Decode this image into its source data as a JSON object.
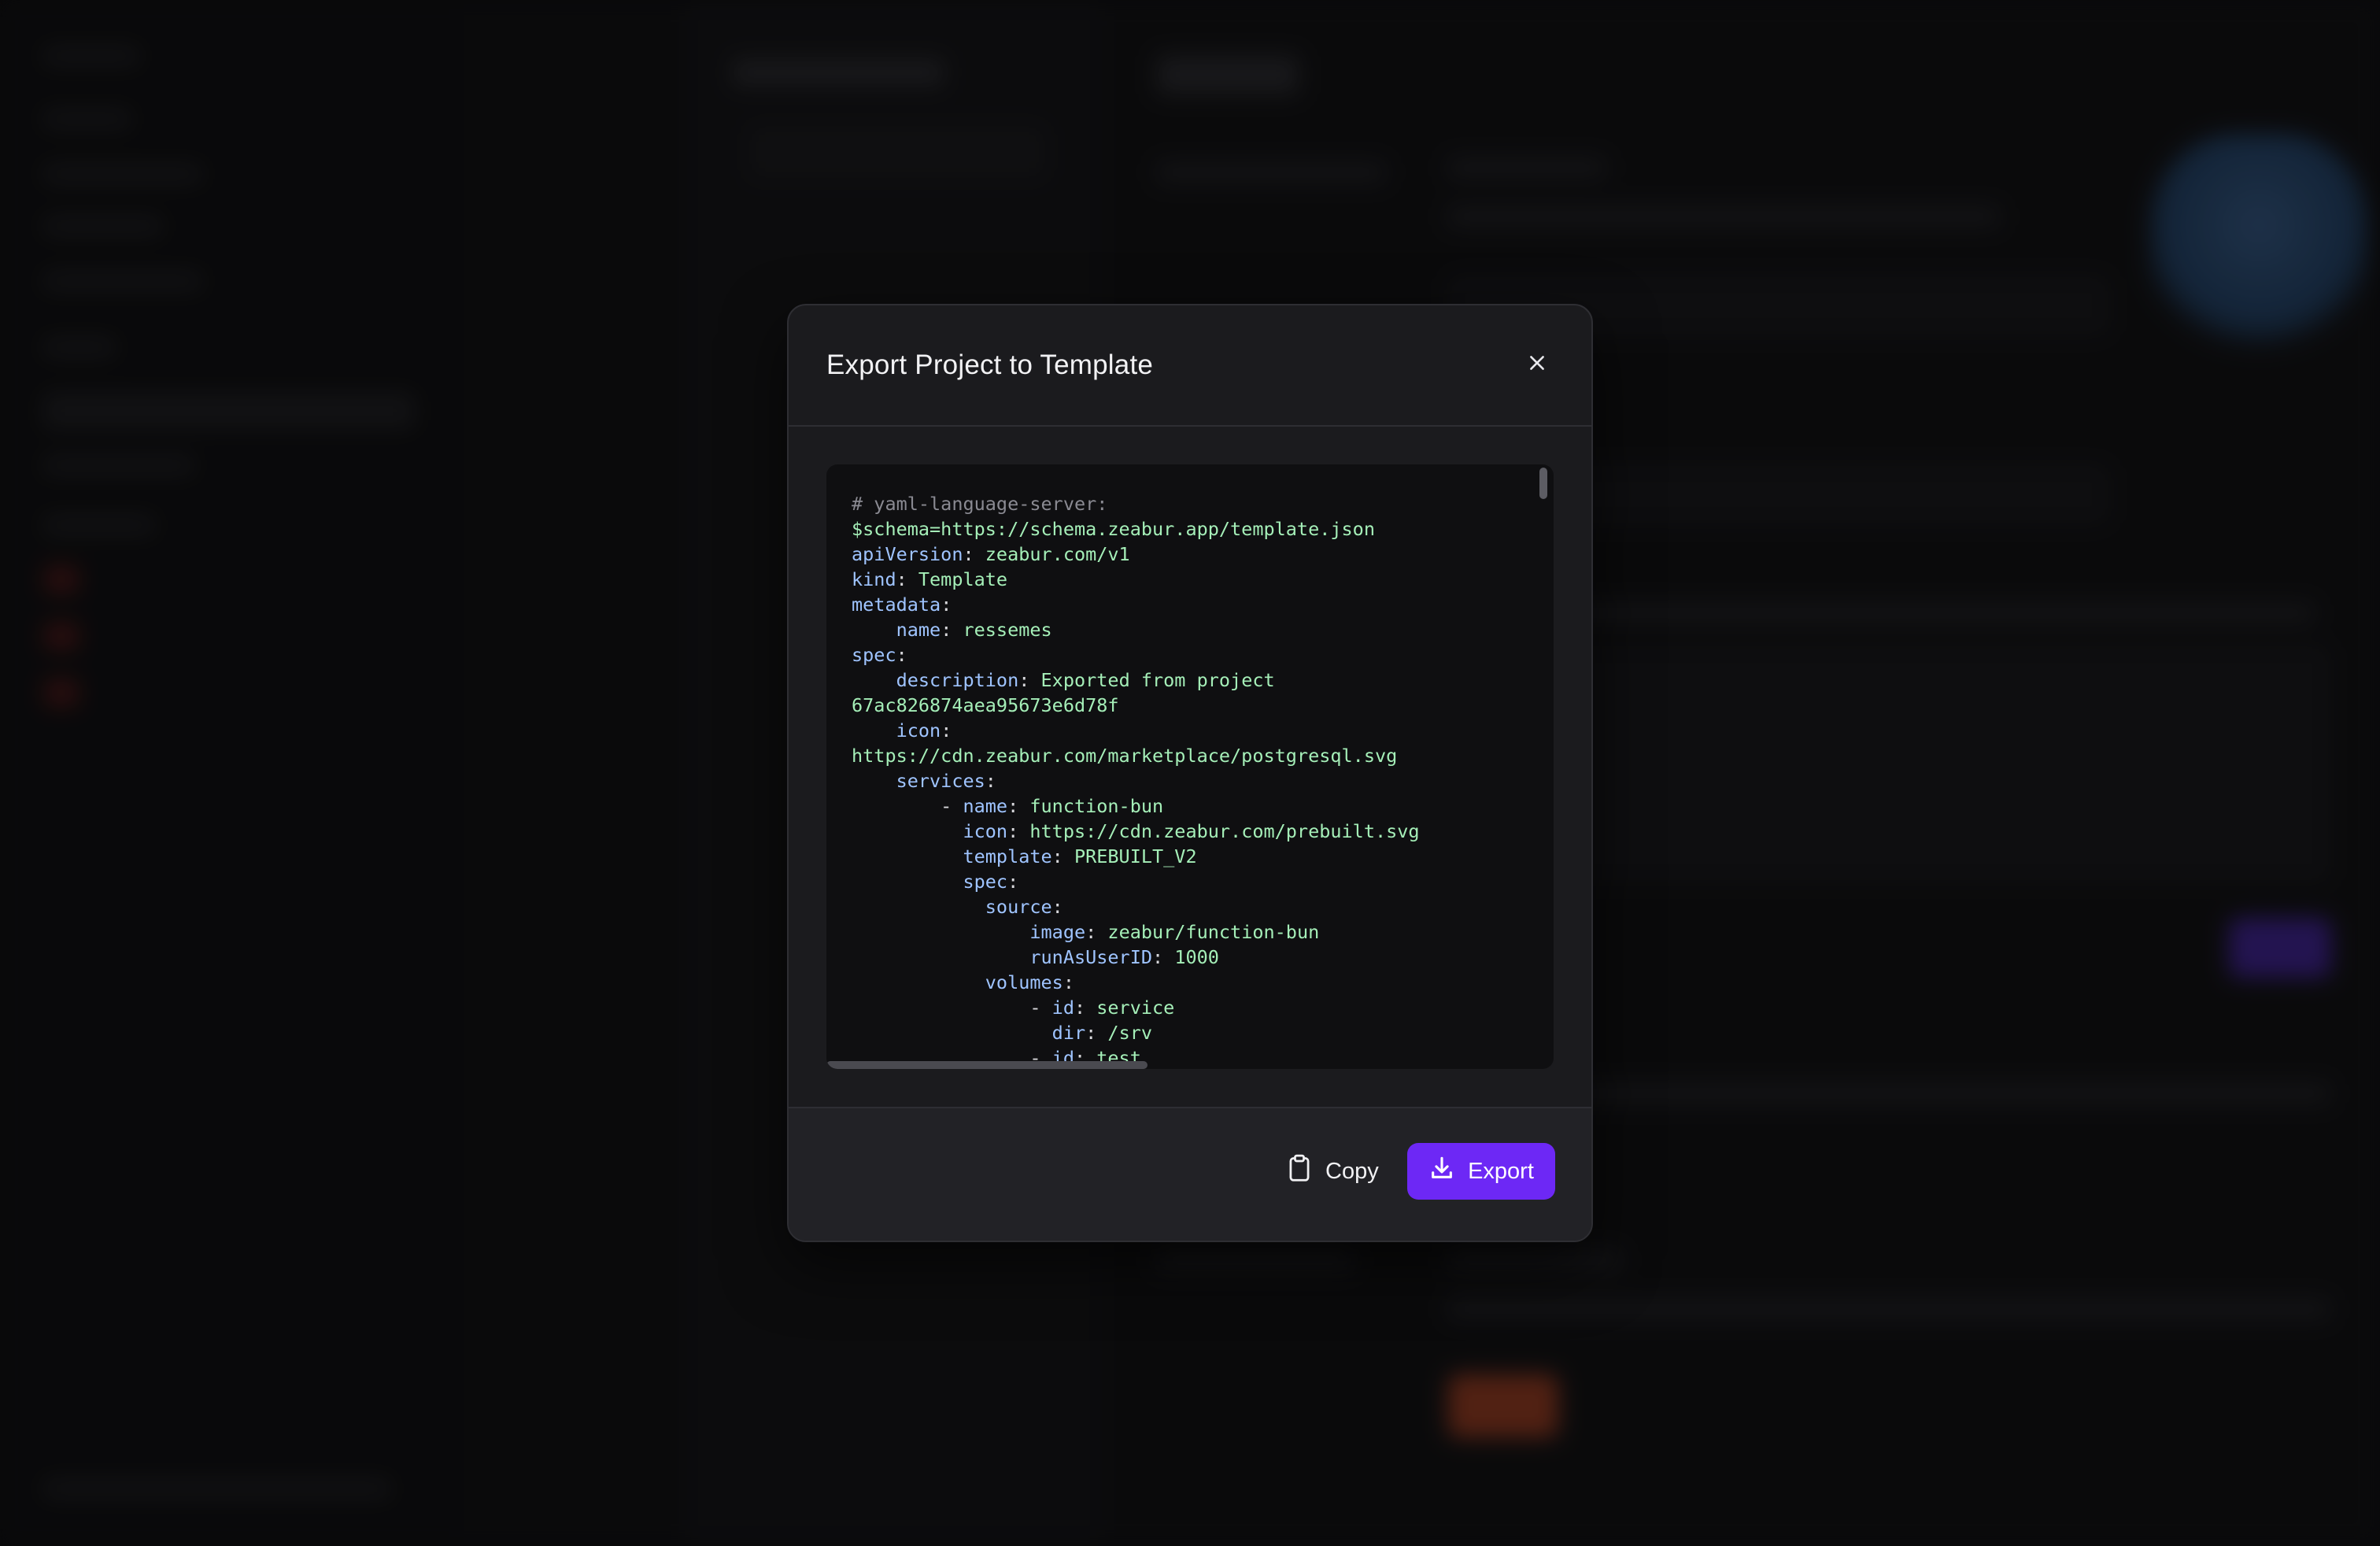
{
  "modal": {
    "title": "Export Project to Template",
    "close_icon": "close-icon"
  },
  "code": {
    "lines": [
      [
        {
          "t": "# yaml-language-server:",
          "c": "comment"
        }
      ],
      [
        {
          "t": "$schema=https://schema.zeabur.app/template.json",
          "c": "val"
        }
      ],
      [
        {
          "t": "apiVersion",
          "c": "key"
        },
        {
          "t": ": ",
          "c": "punct"
        },
        {
          "t": "zeabur.com/v1",
          "c": "val"
        }
      ],
      [
        {
          "t": "kind",
          "c": "key"
        },
        {
          "t": ": ",
          "c": "punct"
        },
        {
          "t": "Template",
          "c": "val"
        }
      ],
      [
        {
          "t": "metadata",
          "c": "key"
        },
        {
          "t": ":",
          "c": "punct"
        }
      ],
      [
        {
          "t": "    ",
          "c": "punct"
        },
        {
          "t": "name",
          "c": "key"
        },
        {
          "t": ": ",
          "c": "punct"
        },
        {
          "t": "ressemes",
          "c": "val"
        }
      ],
      [
        {
          "t": "spec",
          "c": "key"
        },
        {
          "t": ":",
          "c": "punct"
        }
      ],
      [
        {
          "t": "    ",
          "c": "punct"
        },
        {
          "t": "description",
          "c": "key"
        },
        {
          "t": ": ",
          "c": "punct"
        },
        {
          "t": "Exported from project",
          "c": "val"
        }
      ],
      [
        {
          "t": "67ac826874aea95673e6d78f",
          "c": "val"
        }
      ],
      [
        {
          "t": "    ",
          "c": "punct"
        },
        {
          "t": "icon",
          "c": "key"
        },
        {
          "t": ":",
          "c": "punct"
        }
      ],
      [
        {
          "t": "https://cdn.zeabur.com/marketplace/postgresql.svg",
          "c": "val"
        }
      ],
      [
        {
          "t": "    ",
          "c": "punct"
        },
        {
          "t": "services",
          "c": "key"
        },
        {
          "t": ":",
          "c": "punct"
        }
      ],
      [
        {
          "t": "        - ",
          "c": "punct"
        },
        {
          "t": "name",
          "c": "key"
        },
        {
          "t": ": ",
          "c": "punct"
        },
        {
          "t": "function-bun",
          "c": "val"
        }
      ],
      [
        {
          "t": "          ",
          "c": "punct"
        },
        {
          "t": "icon",
          "c": "key"
        },
        {
          "t": ": ",
          "c": "punct"
        },
        {
          "t": "https://cdn.zeabur.com/prebuilt.svg",
          "c": "val"
        }
      ],
      [
        {
          "t": "          ",
          "c": "punct"
        },
        {
          "t": "template",
          "c": "key"
        },
        {
          "t": ": ",
          "c": "punct"
        },
        {
          "t": "PREBUILT_V2",
          "c": "val"
        }
      ],
      [
        {
          "t": "          ",
          "c": "punct"
        },
        {
          "t": "spec",
          "c": "key"
        },
        {
          "t": ":",
          "c": "punct"
        }
      ],
      [
        {
          "t": "            ",
          "c": "punct"
        },
        {
          "t": "source",
          "c": "key"
        },
        {
          "t": ":",
          "c": "punct"
        }
      ],
      [
        {
          "t": "                ",
          "c": "punct"
        },
        {
          "t": "image",
          "c": "key"
        },
        {
          "t": ": ",
          "c": "punct"
        },
        {
          "t": "zeabur/function-bun",
          "c": "val"
        }
      ],
      [
        {
          "t": "                ",
          "c": "punct"
        },
        {
          "t": "runAsUserID",
          "c": "key"
        },
        {
          "t": ": ",
          "c": "punct"
        },
        {
          "t": "1000",
          "c": "val"
        }
      ],
      [
        {
          "t": "            ",
          "c": "punct"
        },
        {
          "t": "volumes",
          "c": "key"
        },
        {
          "t": ":",
          "c": "punct"
        }
      ],
      [
        {
          "t": "                - ",
          "c": "punct"
        },
        {
          "t": "id",
          "c": "key"
        },
        {
          "t": ": ",
          "c": "punct"
        },
        {
          "t": "service",
          "c": "val"
        }
      ],
      [
        {
          "t": "                  ",
          "c": "punct"
        },
        {
          "t": "dir",
          "c": "key"
        },
        {
          "t": ": ",
          "c": "punct"
        },
        {
          "t": "/srv",
          "c": "val"
        }
      ],
      [
        {
          "t": "                - ",
          "c": "punct"
        },
        {
          "t": "id",
          "c": "key"
        },
        {
          "t": ": ",
          "c": "punct"
        },
        {
          "t": "test",
          "c": "val"
        }
      ]
    ]
  },
  "footer": {
    "copy_label": "Copy",
    "copy_icon": "clipboard-icon",
    "export_label": "Export",
    "export_icon": "download-icon"
  },
  "colors": {
    "accent": "#6d28f5",
    "modal_bg": "#1b1b1e",
    "code_bg": "#0f0f11",
    "yaml_key": "#9fc4ff",
    "yaml_value": "#a5efb8",
    "yaml_comment": "#8a8a92"
  }
}
